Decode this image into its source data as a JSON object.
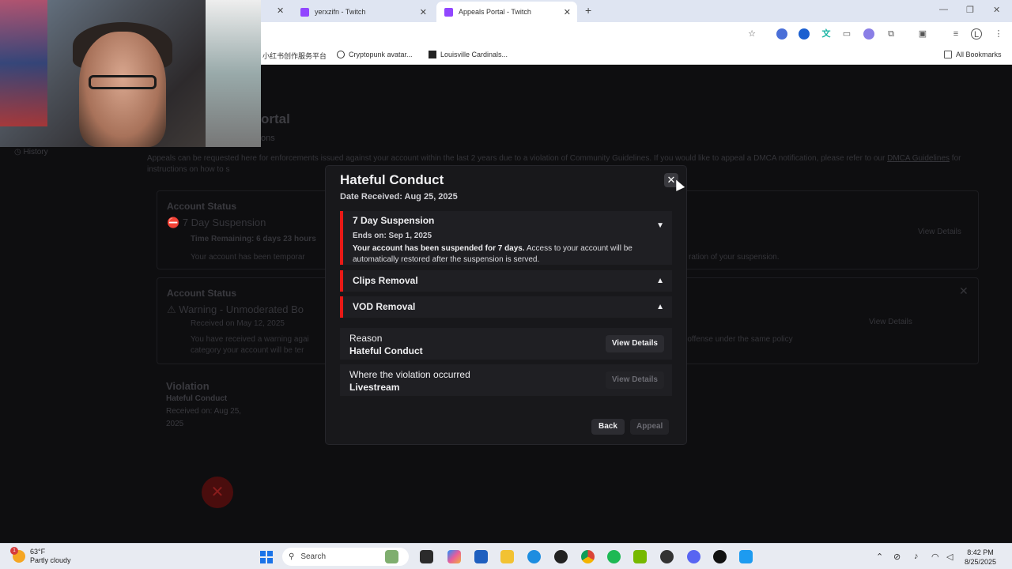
{
  "browser": {
    "tabs": [
      {
        "label": "yerxzifn - Twitch",
        "active": false
      },
      {
        "label": "Appeals Portal - Twitch",
        "active": true
      }
    ],
    "new_tab_label": "+",
    "bookmarks": [
      {
        "label": "小红书创作服务平台"
      },
      {
        "label": "Cryptopunk avatar..."
      },
      {
        "label": "Louisville Cardinals..."
      }
    ],
    "all_bookmarks_label": "All Bookmarks"
  },
  "page": {
    "title": "ortal",
    "subtitle": "ons",
    "history_label": "History",
    "intro_text": "Appeals can be requested here for enforcements issued against your account within the last 2 years due to a violation of Community Guidelines. If you would like to appeal a DMCA notification, please refer to our",
    "intro_link": "DMCA Guidelines",
    "intro_tail": "for instructions on how to s",
    "card1": {
      "heading": "Account Status",
      "status": "7 Day Suspension",
      "time_remaining": "Time Remaining: 6 days 23 hours",
      "body": "Your account has been temporar",
      "body_right": "ration of your suspension.",
      "view_details": "View Details"
    },
    "card2": {
      "heading": "Account Status",
      "status": "Warning - Unmoderated Bo",
      "received": "Received on May 12, 2025",
      "body": "You have received a warning agai",
      "body2": "category your account will be ter",
      "body_right": "n offense under the same policy",
      "view_details": "View Details"
    },
    "violation": {
      "heading": "Violation",
      "type": "Hateful Conduct",
      "received": "Received on: Aug 25,",
      "year": "2025"
    }
  },
  "modal": {
    "title": "Hateful Conduct",
    "date_received": "Date Received: Aug 25, 2025",
    "sections": [
      {
        "heading": "7 Day Suspension",
        "ends_on": "Ends on: Sep 1, 2025",
        "body_bold": "Your account has been suspended for 7 days.",
        "body_rest": "Access to your account will be automatically restored after the suspension is served."
      },
      {
        "heading": "Clips Removal"
      },
      {
        "heading": "VOD Removal"
      }
    ],
    "rows": [
      {
        "label": "Reason",
        "value": "Hateful Conduct",
        "button": "View Details",
        "enabled": true
      },
      {
        "label": "Where the violation occurred",
        "value": "Livestream",
        "button": "View Details",
        "enabled": false
      }
    ],
    "back_label": "Back",
    "appeal_label": "Appeal"
  },
  "taskbar": {
    "weather_temp": "63°F",
    "weather_desc": "Partly cloudy",
    "weather_badge": "1",
    "search_label": "Search",
    "time": "8:42 PM",
    "date": "8/25/2025"
  },
  "colors": {
    "accent_red": "#e91916",
    "twitch_purple": "#9146ff"
  }
}
